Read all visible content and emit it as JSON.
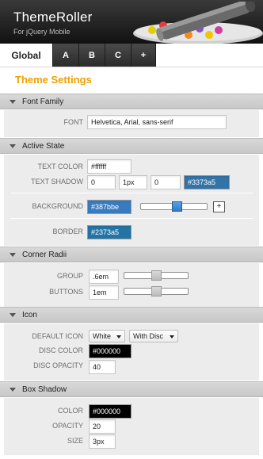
{
  "header": {
    "title": "ThemeRoller",
    "subtitle": "For jQuery Mobile"
  },
  "tabs": [
    {
      "label": "Global",
      "active": true
    },
    {
      "label": "A"
    },
    {
      "label": "B"
    },
    {
      "label": "C"
    },
    {
      "label": "+"
    }
  ],
  "section_title": "Theme Settings",
  "panels": {
    "font_family": {
      "title": "Font Family",
      "font_label": "FONT",
      "font_value": "Helvetica, Arial, sans-serif"
    },
    "active_state": {
      "title": "Active State",
      "text_color_label": "TEXT COLOR",
      "text_color_value": "#ffffff",
      "text_shadow_label": "TEXT SHADOW",
      "text_shadow_x": "0",
      "text_shadow_y": "1px",
      "text_shadow_blur": "0",
      "text_shadow_color": "#3373a5",
      "background_label": "BACKGROUND",
      "background_value": "#387bbe",
      "background_slider_level": 0.55,
      "add_button": "+",
      "border_label": "BORDER",
      "border_value": "#2373a5"
    },
    "corner_radii": {
      "title": "Corner Radii",
      "group_label": "GROUP",
      "group_value": ".6em",
      "group_slider_level": 0.45,
      "buttons_label": "BUTTONS",
      "buttons_value": "1em",
      "buttons_slider_level": 0.45
    },
    "icon": {
      "title": "Icon",
      "default_icon_label": "DEFAULT ICON",
      "icon_color_option": "White",
      "icon_disc_option": "With Disc",
      "disc_color_label": "DISC COLOR",
      "disc_color_value": "#000000",
      "disc_opacity_label": "DISC OPACITY",
      "disc_opacity_value": "40"
    },
    "box_shadow": {
      "title": "Box Shadow",
      "color_label": "COLOR",
      "color_value": "#000000",
      "opacity_label": "OPACITY",
      "opacity_value": "20",
      "size_label": "SIZE",
      "size_value": "3px"
    }
  },
  "colors": {
    "accent": "#f0a000",
    "header_bg": "#1a1a1a",
    "tab_bg": "#3a3a3a",
    "swatch_blue_shadow": "#3373a5",
    "swatch_blue_bg": "#387bbe",
    "swatch_blue_border": "#2373a5",
    "swatch_black": "#000000"
  }
}
